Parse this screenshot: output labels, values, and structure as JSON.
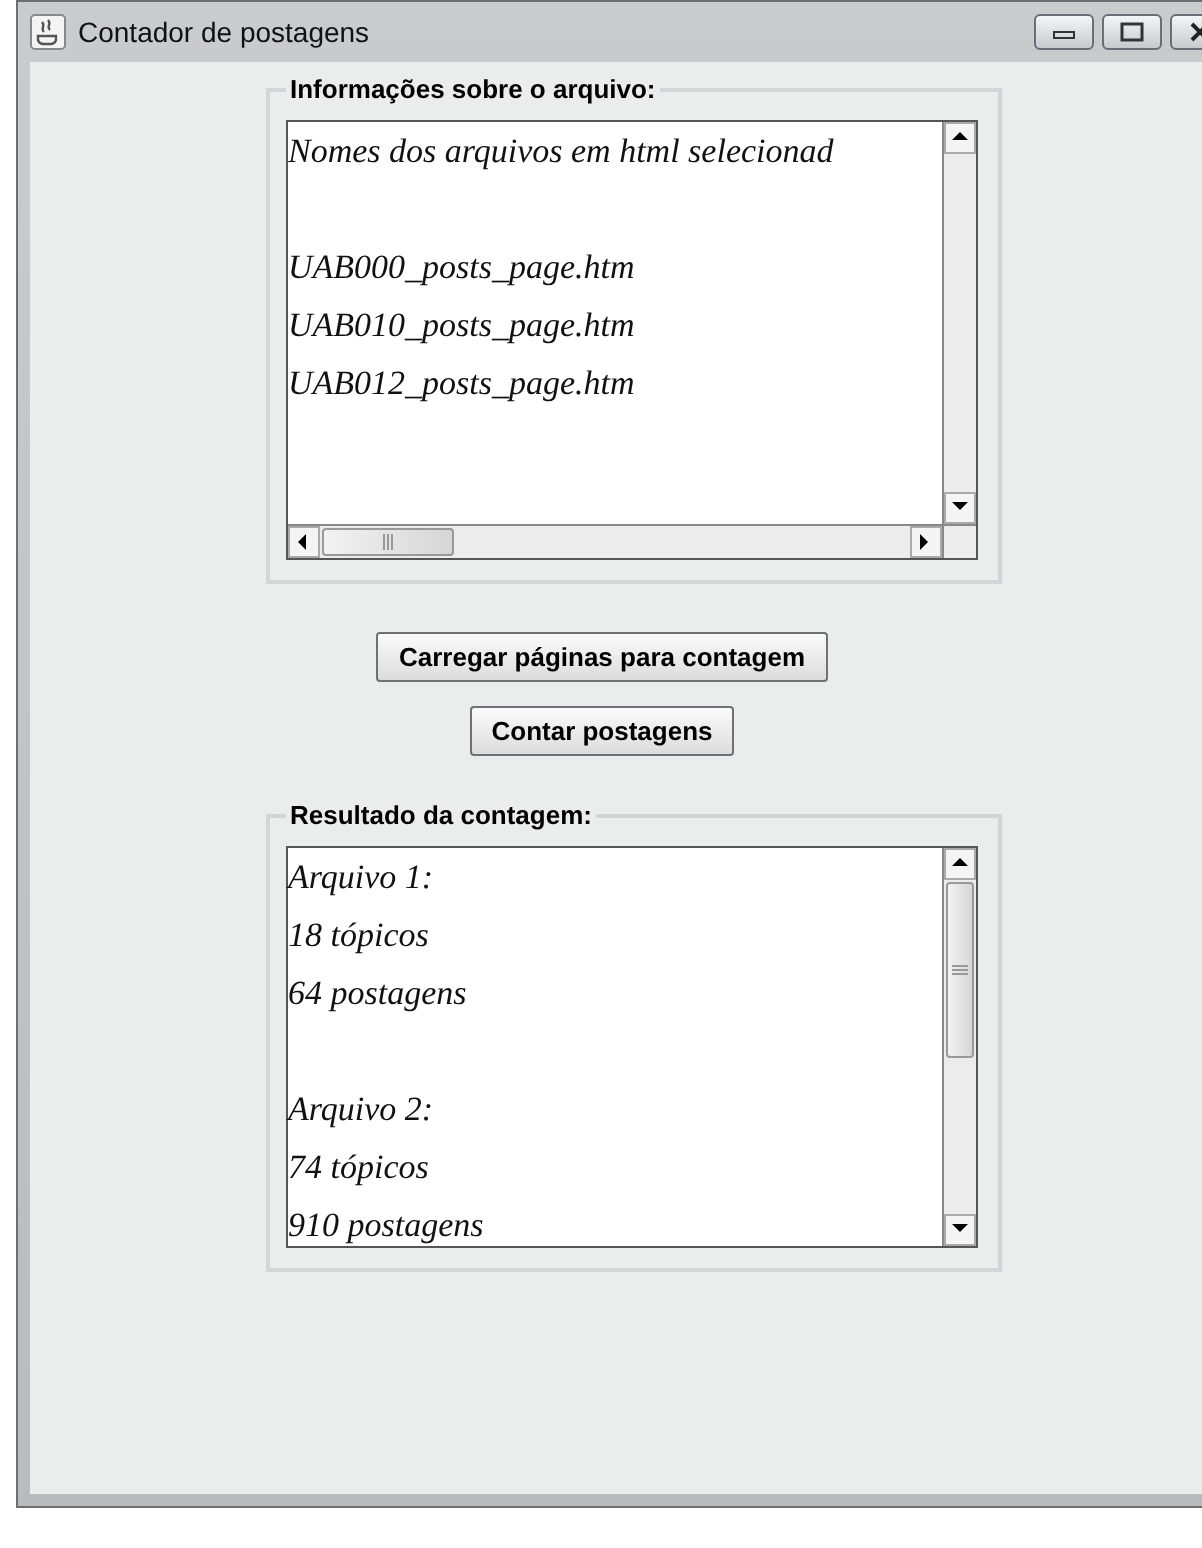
{
  "window": {
    "title": "Contador de postagens"
  },
  "file_info": {
    "legend": "Informações sobre o arquivo:",
    "heading": "Nomes dos arquivos em html selecionad",
    "files": [
      "UAB000_posts_page.htm",
      "UAB010_posts_page.htm",
      "UAB012_posts_page.htm"
    ]
  },
  "buttons": [
    "Carregar páginas para contagem",
    "Contar postagens"
  ],
  "results": {
    "legend": "Resultado da contagem:",
    "blocks": [
      {
        "lines": [
          "Arquivo 1:",
          "18 tópicos",
          "64 postagens"
        ]
      },
      {
        "lines": [
          "Arquivo 2:",
          "74 tópicos",
          "910 postagens"
        ]
      }
    ]
  }
}
